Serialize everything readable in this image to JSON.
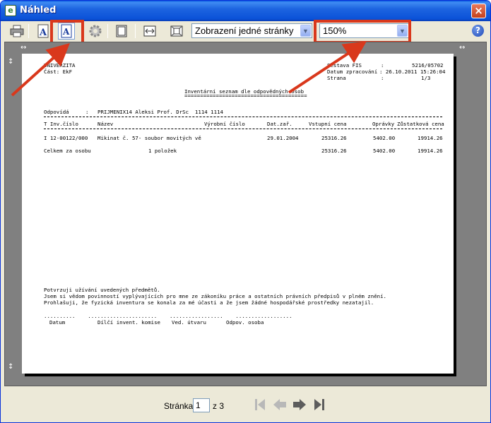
{
  "window": {
    "title": "Náhled",
    "close_label": "×"
  },
  "toolbar": {
    "view_mode": "Zobrazení jedné stránky",
    "zoom": "150%",
    "help_label": "?"
  },
  "ruler": {
    "top_left": "↔",
    "top_right": "↔",
    "side_top": "↕",
    "side_bottom": "↕"
  },
  "report": {
    "org": "UNIVERZITA",
    "part": "Část: EkF",
    "set_label": "Sestava FIS",
    "set_sep": ":",
    "set_value": "5216/05702",
    "date_label": "Datum zpracování",
    "date_value": ": 26.10.2011 15:26:04",
    "page_label": "Strana",
    "page_sep": ":",
    "page_value": "1/3",
    "title": "Inventární seznam dle odpovědných osob",
    "title_underline": "=======================================",
    "resp_label": "Odpovídá",
    "resp_sep": ":",
    "resp_value": "PRIJMENIX14 Aleksi Prof. DrSc  1114 1114",
    "columns": [
      "T Inv.číslo",
      "Název",
      "Výrobní číslo",
      "Dat.zař.",
      "Vstupní cena",
      "Oprávky",
      "Zůstatková cena"
    ],
    "rows": [
      [
        "I 12-00122/000",
        "Mikinat č. 57- soubor movitých vě",
        "",
        "29.01.2004",
        "25316.26",
        "5402.00",
        "19914.26"
      ]
    ],
    "total_label": "Celkem za osobu",
    "total_count": "1 položek",
    "total_price": "25316.26",
    "total_dep": "5402.00",
    "total_rest": "19914.26",
    "confirm": [
      "Potvrzuji užívání uvedených předmětů.",
      "Jsem si vědom povinností vyplývajících pro mne ze zákoníku práce a ostatních právních předpisů v plném znění.",
      "Prohlašuji, že fyzická inventura se konala za mé účasti a že jsem žádné hospodářské prostředky nezatajil."
    ],
    "sign_dots": "..........    ......................    .................    ..................",
    "signatures": [
      "Datum",
      "Dílčí invent. komise",
      "Ved. útvaru",
      "Odpov. osoba"
    ]
  },
  "nav": {
    "page_label": "Stránka",
    "page_value": "1",
    "page_of": "z 3"
  },
  "colors": {
    "highlight": "#d9381c",
    "title_bar": "#0b52d8",
    "preview_bg": "#808080"
  }
}
